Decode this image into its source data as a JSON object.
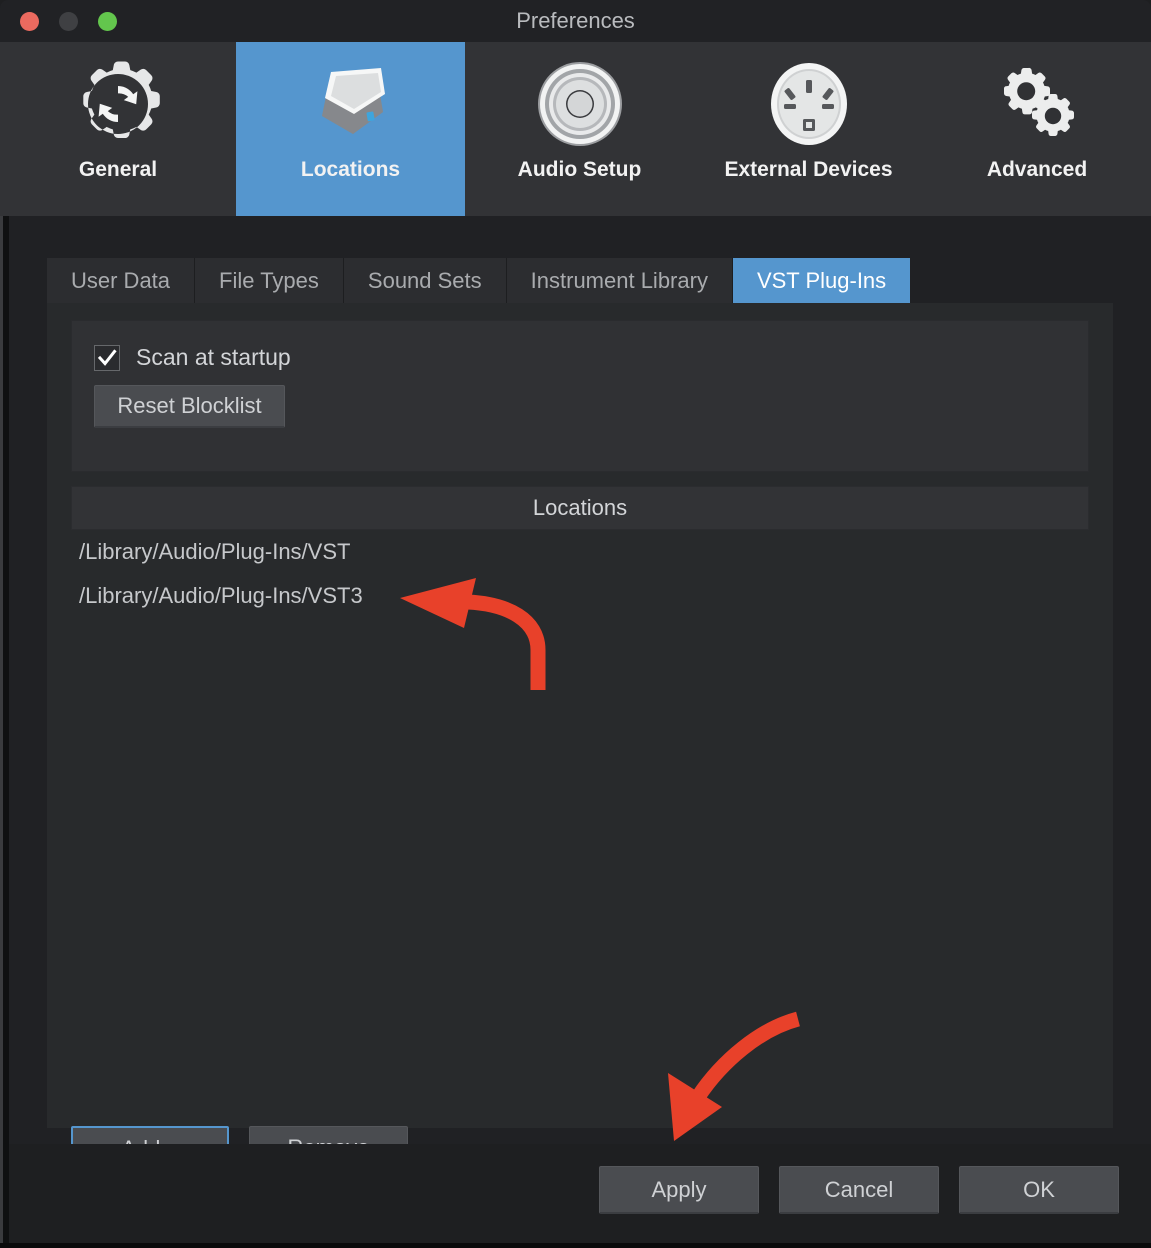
{
  "window": {
    "title": "Preferences",
    "traffic_lights": [
      "close-button",
      "minimize-button",
      "zoom-button"
    ]
  },
  "toolbar": {
    "items": [
      {
        "label": "General",
        "icon": "gear-refresh-icon",
        "selected": false
      },
      {
        "label": "Locations",
        "icon": "hard-drive-icon",
        "selected": true
      },
      {
        "label": "Audio Setup",
        "icon": "speaker-knob-icon",
        "selected": false
      },
      {
        "label": "External Devices",
        "icon": "power-socket-icon",
        "selected": false
      },
      {
        "label": "Advanced",
        "icon": "two-gears-icon",
        "selected": false
      }
    ]
  },
  "tabs": [
    {
      "label": "User Data",
      "active": false
    },
    {
      "label": "File Types",
      "active": false
    },
    {
      "label": "Sound Sets",
      "active": false
    },
    {
      "label": "Instrument Library",
      "active": false
    },
    {
      "label": "VST Plug-Ins",
      "active": true
    }
  ],
  "scan": {
    "checkbox_label": "Scan at startup",
    "checked": true,
    "reset_button": "Reset Blocklist"
  },
  "locations": {
    "header": "Locations",
    "items": [
      "/Library/Audio/Plug-Ins/VST",
      "/Library/Audio/Plug-Ins/VST3"
    ],
    "add_button": "Add...",
    "remove_button": "Remove"
  },
  "footer": {
    "apply_button": "Apply",
    "cancel_button": "Cancel",
    "ok_button": "OK"
  },
  "colors": {
    "accent_blue": "#5596ce",
    "annotation_red": "#e8412a",
    "window_bg": "#1e1f21",
    "toolbar_bg": "#323336",
    "panel_bg": "#282a2c",
    "button_bg": "#4a4c50",
    "text": "#d3d5d8"
  },
  "annotations": [
    {
      "name": "arrow-to-vst3-path",
      "shape": "curved-arrow-left"
    },
    {
      "name": "arrow-to-apply-button",
      "shape": "curved-arrow-down-left"
    }
  ]
}
